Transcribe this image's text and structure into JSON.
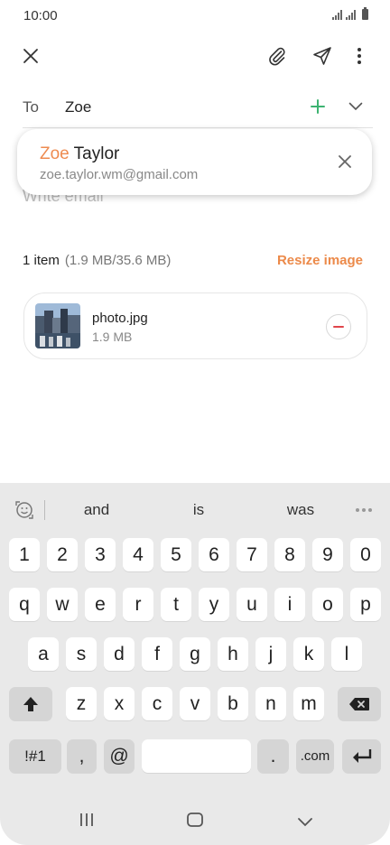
{
  "status": {
    "time": "10:00"
  },
  "toolbar": {
    "close": "close-icon",
    "attach": "paperclip-icon",
    "send": "send-icon",
    "more": "more-vertical-icon"
  },
  "compose": {
    "to_label": "To",
    "to_value": "Zoe",
    "add_icon": "plus-icon",
    "expand_icon": "chevron-down-icon",
    "body_placeholder": "Write email"
  },
  "suggestion": {
    "name_match": "Zoe",
    "name_rest": " Taylor",
    "email": "zoe.taylor.wm@gmail.com"
  },
  "attachments": {
    "count_label": "1 item",
    "size_label": "(1.9 MB/35.6 MB)",
    "resize_label": "Resize image",
    "items": [
      {
        "name": "photo.jpg",
        "size": "1.9 MB"
      }
    ]
  },
  "keyboard": {
    "suggestions": [
      "and",
      "is",
      "was"
    ],
    "row_numbers": [
      "1",
      "2",
      "3",
      "4",
      "5",
      "6",
      "7",
      "8",
      "9",
      "0"
    ],
    "row_top": [
      "q",
      "w",
      "e",
      "r",
      "t",
      "y",
      "u",
      "i",
      "o",
      "p"
    ],
    "row_mid": [
      "a",
      "s",
      "d",
      "f",
      "g",
      "h",
      "j",
      "k",
      "l"
    ],
    "row_bottom": [
      "z",
      "x",
      "c",
      "v",
      "b",
      "n",
      "m"
    ],
    "sym_label": "!#1",
    "comma_label": ",",
    "at_label": "@",
    "period_label": ".",
    "com_label": ".com"
  },
  "colors": {
    "accent": "#ec8a4a",
    "add_green": "#3cb371",
    "remove_red": "#e0454b",
    "keyboard_bg": "#e9e9e9"
  }
}
